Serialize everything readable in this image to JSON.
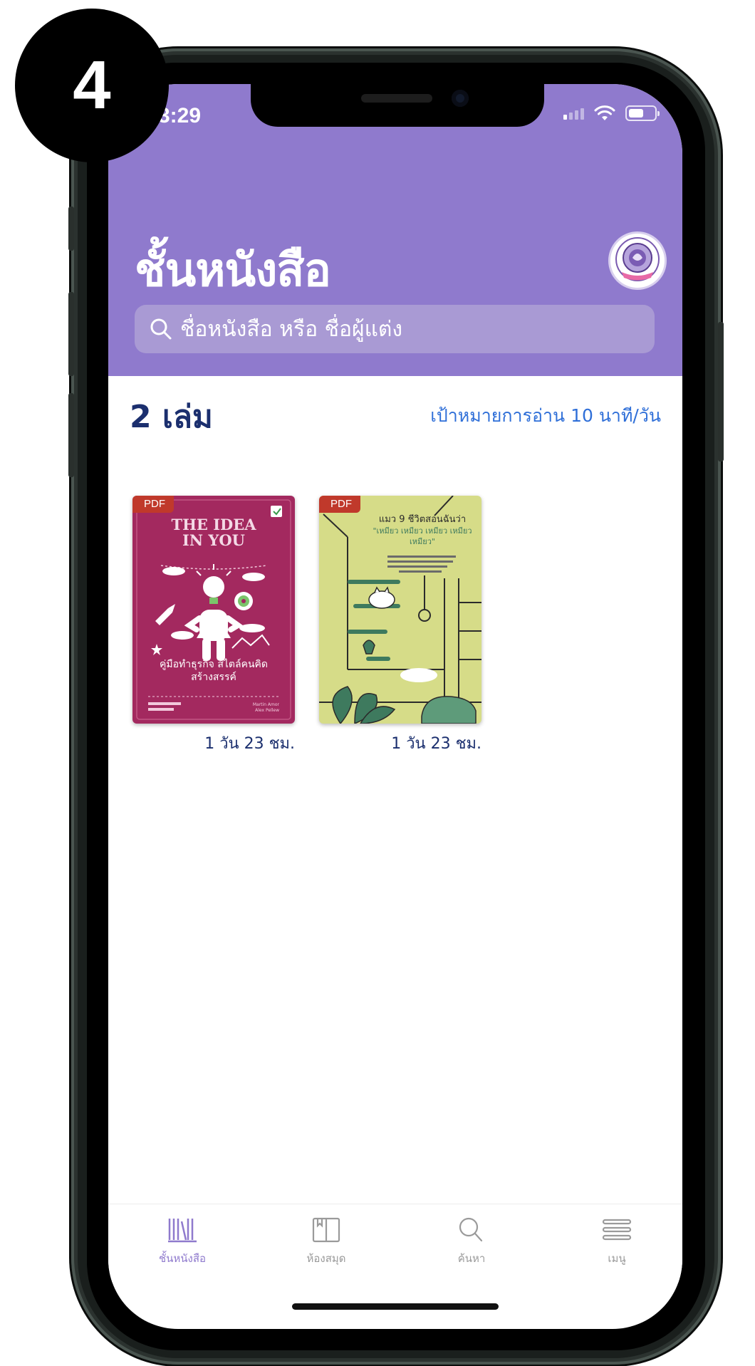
{
  "step_number": "4",
  "status_bar": {
    "time": "3:29"
  },
  "header": {
    "title": "ชั้นหนังสือ",
    "search_placeholder": "ชื่อหนังสือ หรือ ชื่อผู้แต่ง"
  },
  "shelf": {
    "count_label": "2 เล่ม",
    "reading_goal": "เป้าหมายการอ่าน 10 นาที/วัน"
  },
  "books": [
    {
      "badge": "PDF",
      "cover_title": "THE IDEA IN YOU",
      "cover_subtitle": "คู่มือทำธุรกิจ สไตล์คนคิดสร้างสรรค์",
      "cover_authors": "Martin Amor\nAlex Pellew",
      "time_left": "1 วัน 23 ชม.",
      "cover_color": "#a3295f"
    },
    {
      "badge": "PDF",
      "cover_title": "แมว 9 ชีวิตสอนฉันว่า",
      "cover_subtitle": "\"เหมียว เหมียว เหมียว เหมียว เหมียว\"",
      "time_left": "1 วัน 23 ชม.",
      "cover_color": "#d6dc88"
    }
  ],
  "tabbar": {
    "tabs": [
      {
        "label": "ชั้นหนังสือ",
        "icon": "bookshelf-icon",
        "active": true
      },
      {
        "label": "ห้องสมุด",
        "icon": "library-book-icon",
        "active": false
      },
      {
        "label": "ค้นหา",
        "icon": "search-icon",
        "active": false
      },
      {
        "label": "เมนู",
        "icon": "menu-icon",
        "active": false
      }
    ]
  },
  "colors": {
    "header_purple": "#8f7acd",
    "accent_blue": "#2f6fd8",
    "navy_text": "#1b2f6e",
    "pdf_badge_red": "#c0392b"
  }
}
